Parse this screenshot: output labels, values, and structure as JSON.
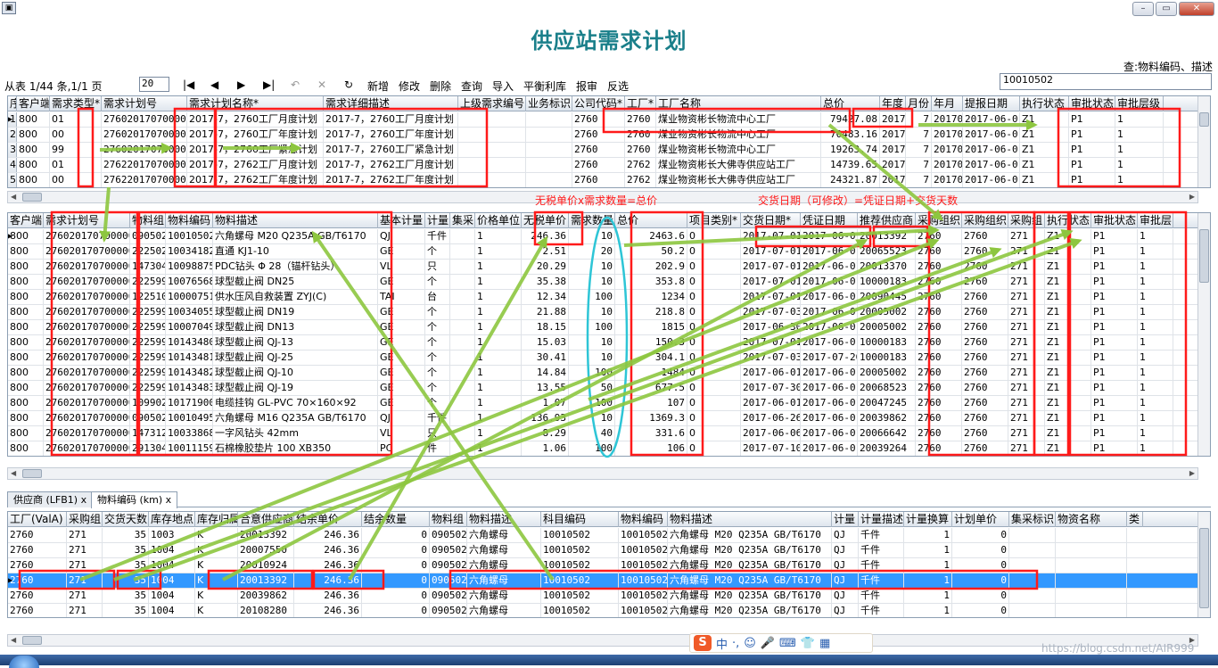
{
  "window": {
    "title": "供应站需求计划",
    "min_glyph": "–",
    "max_glyph": "▭",
    "close_glyph": "✕",
    "sys_glyph": "▣"
  },
  "query_label": "查:物料编码、描述",
  "toolbar": {
    "record_info": "从表 1/44 条,1/1 页",
    "page_input": "20",
    "first": "|◀",
    "prev": "◀",
    "next": "▶",
    "last": "▶|",
    "undo": "↶",
    "cancel": "✕",
    "refresh": "↻",
    "new": "新增",
    "edit": "修改",
    "delete": "删除",
    "query": "查询",
    "import": "导入",
    "balance": "平衡利库",
    "report": "报审",
    "reverse": "反选",
    "search_value": "10010502"
  },
  "plan_grid": {
    "columns": [
      "序号",
      "客户端",
      "需求类型*",
      "需求计划号",
      "需求计划名称*",
      "需求详细描述",
      "上级需求编号",
      "业务标识",
      "公司代码*",
      "工厂*",
      "工厂名称",
      "总价",
      "年度",
      "月份",
      "年月",
      "提报日期",
      "执行状态",
      "审批状态",
      "审批层级"
    ],
    "rows": [
      [
        "1",
        "800",
        "01",
        "2760201707000001",
        "2017-7，2760工厂月度计划",
        "2017-7，2760工厂月度计划",
        "",
        "",
        "2760",
        "2760",
        "煤业物资彬长物流中心工厂",
        "79427.08",
        "2017",
        "7",
        "201707",
        "2017-06-01",
        "Z1",
        "P1",
        "1"
      ],
      [
        "2",
        "800",
        "00",
        "2760201707000001",
        "2017-7，2760工厂年度计划",
        "2017-7，2760工厂年度计划",
        "",
        "",
        "2760",
        "2760",
        "煤业物资彬长物流中心工厂",
        "70483.16",
        "2017",
        "7",
        "201707",
        "2017-06-01",
        "Z1",
        "P1",
        "1"
      ],
      [
        "3",
        "800",
        "99",
        "2760201707000001",
        "2017-7，2760工厂紧急计划",
        "2017-7，2760工厂紧急计划",
        "",
        "",
        "2760",
        "2760",
        "煤业物资彬长物流中心工厂",
        "19263.74",
        "2017",
        "7",
        "201707",
        "2017-06-01",
        "Z1",
        "P1",
        "1"
      ],
      [
        "4",
        "800",
        "01",
        "2762201707000001",
        "2017-7，2762工厂月度计划",
        "2017-7，2762工厂月度计划",
        "",
        "",
        "2760",
        "2762",
        "煤业物资彬长大佛寺供应站工厂",
        "14739.65",
        "2017",
        "7",
        "201707",
        "2017-06-01",
        "Z1",
        "P1",
        "1"
      ],
      [
        "5",
        "800",
        "00",
        "2762201707000001",
        "2017-7，2762工厂年度计划",
        "2017-7，2762工厂年度计划",
        "",
        "",
        "2760",
        "2762",
        "煤业物资彬长大佛寺供应站工厂",
        "24321.87",
        "2017",
        "7",
        "201707",
        "2017-06-01",
        "Z1",
        "P1",
        "1"
      ]
    ]
  },
  "notes": {
    "price_formula": "无税单价x需求数量=总价",
    "date_formula": "交货日期（可修改）=凭证日期+交货天数"
  },
  "detail_grid": {
    "columns": [
      "客户端",
      "需求计划号",
      "物料组",
      "物料编码",
      "物料描述",
      "基本计量",
      "计量",
      "集采",
      "价格单位",
      "无税单价",
      "需求数量",
      "总价",
      "项目类别*",
      "交货日期*",
      "凭证日期",
      "推荐供应商",
      "采购组织",
      "采购组织",
      "采购组",
      "执行状态",
      "审批状态",
      "审批层"
    ],
    "rows": [
      [
        "800",
        "2760201707000001",
        "090502",
        "10010502",
        "六角螺母 M20 Q235A GB/T6170",
        "QJ",
        "千件",
        "",
        "1",
        "246.36",
        "10",
        "2463.6",
        "0",
        "2017-07-01",
        "2017-06-01",
        "20013392",
        "2760",
        "2760",
        "271",
        "Z1",
        "P1",
        "1"
      ],
      [
        "800",
        "2760201707000001",
        "222502",
        "10034182",
        "直通 KJ1-10",
        "GE",
        "个",
        "",
        "1",
        "2.51",
        "20",
        "50.2",
        "0",
        "2017-07-01",
        "2017-06-01",
        "20065523",
        "2760",
        "2760",
        "271",
        "Z1",
        "P1",
        "1"
      ],
      [
        "800",
        "2760201707000001",
        "147304",
        "10098875",
        "PDC钻头 Φ 28（锚杆钻头）",
        "VL",
        "只",
        "",
        "1",
        "20.29",
        "10",
        "202.9",
        "0",
        "2017-07-01",
        "2017-06-01",
        "20013370",
        "2760",
        "2760",
        "271",
        "Z1",
        "P1",
        "1"
      ],
      [
        "800",
        "2760201707000001",
        "222599",
        "10076568",
        "球型截止阀 DN25",
        "GE",
        "个",
        "",
        "1",
        "35.38",
        "10",
        "353.8",
        "0",
        "2017-07-01",
        "2017-06-01",
        "10000183",
        "2760",
        "2760",
        "271",
        "Z1",
        "P1",
        "1"
      ],
      [
        "800",
        "2760201707000001",
        "122510",
        "10000751",
        "供水压风自救装置 ZYJ(C)",
        "TAI",
        "台",
        "",
        "1",
        "12.34",
        "100",
        "1234",
        "0",
        "2017-07-01",
        "2017-06-01",
        "20090445",
        "2760",
        "2760",
        "271",
        "Z1",
        "P1",
        "1"
      ],
      [
        "800",
        "2760201707000001",
        "222599",
        "10034055",
        "球型截止阀 DN19",
        "GE",
        "个",
        "",
        "1",
        "21.88",
        "10",
        "218.8",
        "0",
        "2017-07-03",
        "2017-06-01",
        "20005002",
        "2760",
        "2760",
        "271",
        "Z1",
        "P1",
        "1"
      ],
      [
        "800",
        "2760201707000001",
        "222599",
        "10007049",
        "球型截止阀 DN13",
        "GE",
        "个",
        "",
        "1",
        "18.15",
        "100",
        "1815",
        "0",
        "2017-06-30",
        "2017-06-01",
        "20005002",
        "2760",
        "2760",
        "271",
        "Z1",
        "P1",
        "1"
      ],
      [
        "800",
        "2760201707000001",
        "222599",
        "10143480",
        "球型截止阀 QJ-13",
        "GE",
        "个",
        "",
        "1",
        "15.03",
        "10",
        "150.3",
        "0",
        "2017-07-01",
        "2017-06-01",
        "10000183",
        "2760",
        "2760",
        "271",
        "Z1",
        "P1",
        "1"
      ],
      [
        "800",
        "2760201707000001",
        "222599",
        "10143481",
        "球型截止阀 QJ-25",
        "GE",
        "个",
        "",
        "1",
        "30.41",
        "10",
        "304.1",
        "0",
        "2017-07-03",
        "2017-07-20",
        "10000183",
        "2760",
        "2760",
        "271",
        "Z1",
        "P1",
        "1"
      ],
      [
        "800",
        "2760201707000001",
        "222599",
        "10143482",
        "球型截止阀 QJ-10",
        "GE",
        "个",
        "",
        "1",
        "14.84",
        "100",
        "1484",
        "0",
        "2017-06-01",
        "2017-06-01",
        "20005002",
        "2760",
        "2760",
        "271",
        "Z1",
        "P1",
        "1"
      ],
      [
        "800",
        "2760201707000001",
        "222599",
        "10143483",
        "球型截止阀 QJ-19",
        "GE",
        "个",
        "",
        "1",
        "13.55",
        "50",
        "677.5",
        "0",
        "2017-07-30",
        "2017-06-01",
        "20068523",
        "2760",
        "2760",
        "271",
        "Z1",
        "P1",
        "1"
      ],
      [
        "800",
        "2760201707000001",
        "109902",
        "10171900",
        "电缆挂钩 GL-PVC 70×160×92",
        "GE",
        "个",
        "",
        "1",
        "1.07",
        "100",
        "107",
        "0",
        "2017-06-01",
        "2017-06-01",
        "20047245",
        "2760",
        "2760",
        "271",
        "Z1",
        "P1",
        "1"
      ],
      [
        "800",
        "2760201707000001",
        "090502",
        "10010495",
        "六角螺母 M16 Q235A GB/T6170",
        "QJ",
        "千件",
        "",
        "1",
        "136.93",
        "10",
        "1369.3",
        "0",
        "2017-06-26",
        "2017-06-01",
        "20039862",
        "2760",
        "2760",
        "271",
        "Z1",
        "P1",
        "1"
      ],
      [
        "800",
        "2760201707000001",
        "147312",
        "10033868",
        "一字风钻头 42mm",
        "VL",
        "只",
        "",
        "1",
        "8.29",
        "40",
        "331.6",
        "0",
        "2017-06-06",
        "2017-06-01",
        "20066642",
        "2760",
        "2760",
        "271",
        "Z1",
        "P1",
        "1"
      ],
      [
        "800",
        "2760201707000001",
        "291304",
        "10011159",
        "石棉橡胶垫片 100 XB350",
        "PC",
        "件",
        "",
        "1",
        "1.06",
        "100",
        "106",
        "0",
        "2017-07-10",
        "2017-06-01",
        "20039264",
        "2760",
        "2760",
        "271",
        "Z1",
        "P1",
        "1"
      ]
    ]
  },
  "tabs": [
    {
      "label": "供应商 (LFB1)",
      "close": "x"
    },
    {
      "label": "物料编码 (km)",
      "close": "x"
    }
  ],
  "vendor_grid": {
    "columns": [
      "工厂(ValA)",
      "采购组",
      "交货天数",
      "库存地点",
      "库存归属",
      "合意供应商",
      "结余单价",
      "结余数量",
      "物料组",
      "物料描述",
      "科目编码",
      "物料编码",
      "物料描述",
      "计量",
      "计量描述",
      "计量换算",
      "计划单价",
      "集采标识",
      "物资名称",
      "类"
    ],
    "rows": [
      [
        "2760",
        "271",
        "35",
        "1003",
        "K",
        "20013392",
        "246.36",
        "0",
        "090502",
        "六角螺母",
        "10010502",
        "10010502",
        "六角螺母 M20 Q235A GB/T6170",
        "QJ",
        "千件",
        "1",
        "0",
        "",
        ""
      ],
      [
        "2760",
        "271",
        "35",
        "1004",
        "K",
        "20007550",
        "246.36",
        "0",
        "090502",
        "六角螺母",
        "10010502",
        "10010502",
        "六角螺母 M20 Q235A GB/T6170",
        "QJ",
        "千件",
        "1",
        "0",
        "",
        ""
      ],
      [
        "2760",
        "271",
        "35",
        "1004",
        "K",
        "20010924",
        "246.36",
        "0",
        "090502",
        "六角螺母",
        "10010502",
        "10010502",
        "六角螺母 M20 Q235A GB/T6170",
        "QJ",
        "千件",
        "1",
        "0",
        "",
        ""
      ],
      [
        "2760",
        "271",
        "35",
        "1004",
        "K",
        "20013392",
        "246.36",
        "0",
        "090502",
        "六角螺母",
        "10010502",
        "10010502",
        "六角螺母 M20 Q235A GB/T6170",
        "QJ",
        "千件",
        "1",
        "0",
        "",
        ""
      ],
      [
        "2760",
        "271",
        "35",
        "1004",
        "K",
        "20039862",
        "246.36",
        "0",
        "090502",
        "六角螺母",
        "10010502",
        "10010502",
        "六角螺母 M20 Q235A GB/T6170",
        "QJ",
        "千件",
        "1",
        "0",
        "",
        ""
      ],
      [
        "2760",
        "271",
        "35",
        "1004",
        "K",
        "20108280",
        "246.36",
        "0",
        "090502",
        "六角螺母",
        "10010502",
        "10010502",
        "六角螺母 M20 Q235A GB/T6170",
        "QJ",
        "千件",
        "1",
        "0",
        "",
        ""
      ]
    ],
    "selected_row": 3
  },
  "ime": {
    "logo": "S",
    "lang": "中",
    "punct": "·,",
    "emoji": "☺",
    "mic": "🎤",
    "keyboard": "⌨",
    "shirt": "👕",
    "apps": "▦"
  },
  "watermark": "https://blog.csdn.net/AIR999",
  "colors": {
    "title": "#1a7f8a",
    "annotation_red": "#ff1a1a",
    "arrow_green": "#8dc63f",
    "ellipse_cyan": "#2ec5d6",
    "selected_row": "#3399ff"
  }
}
